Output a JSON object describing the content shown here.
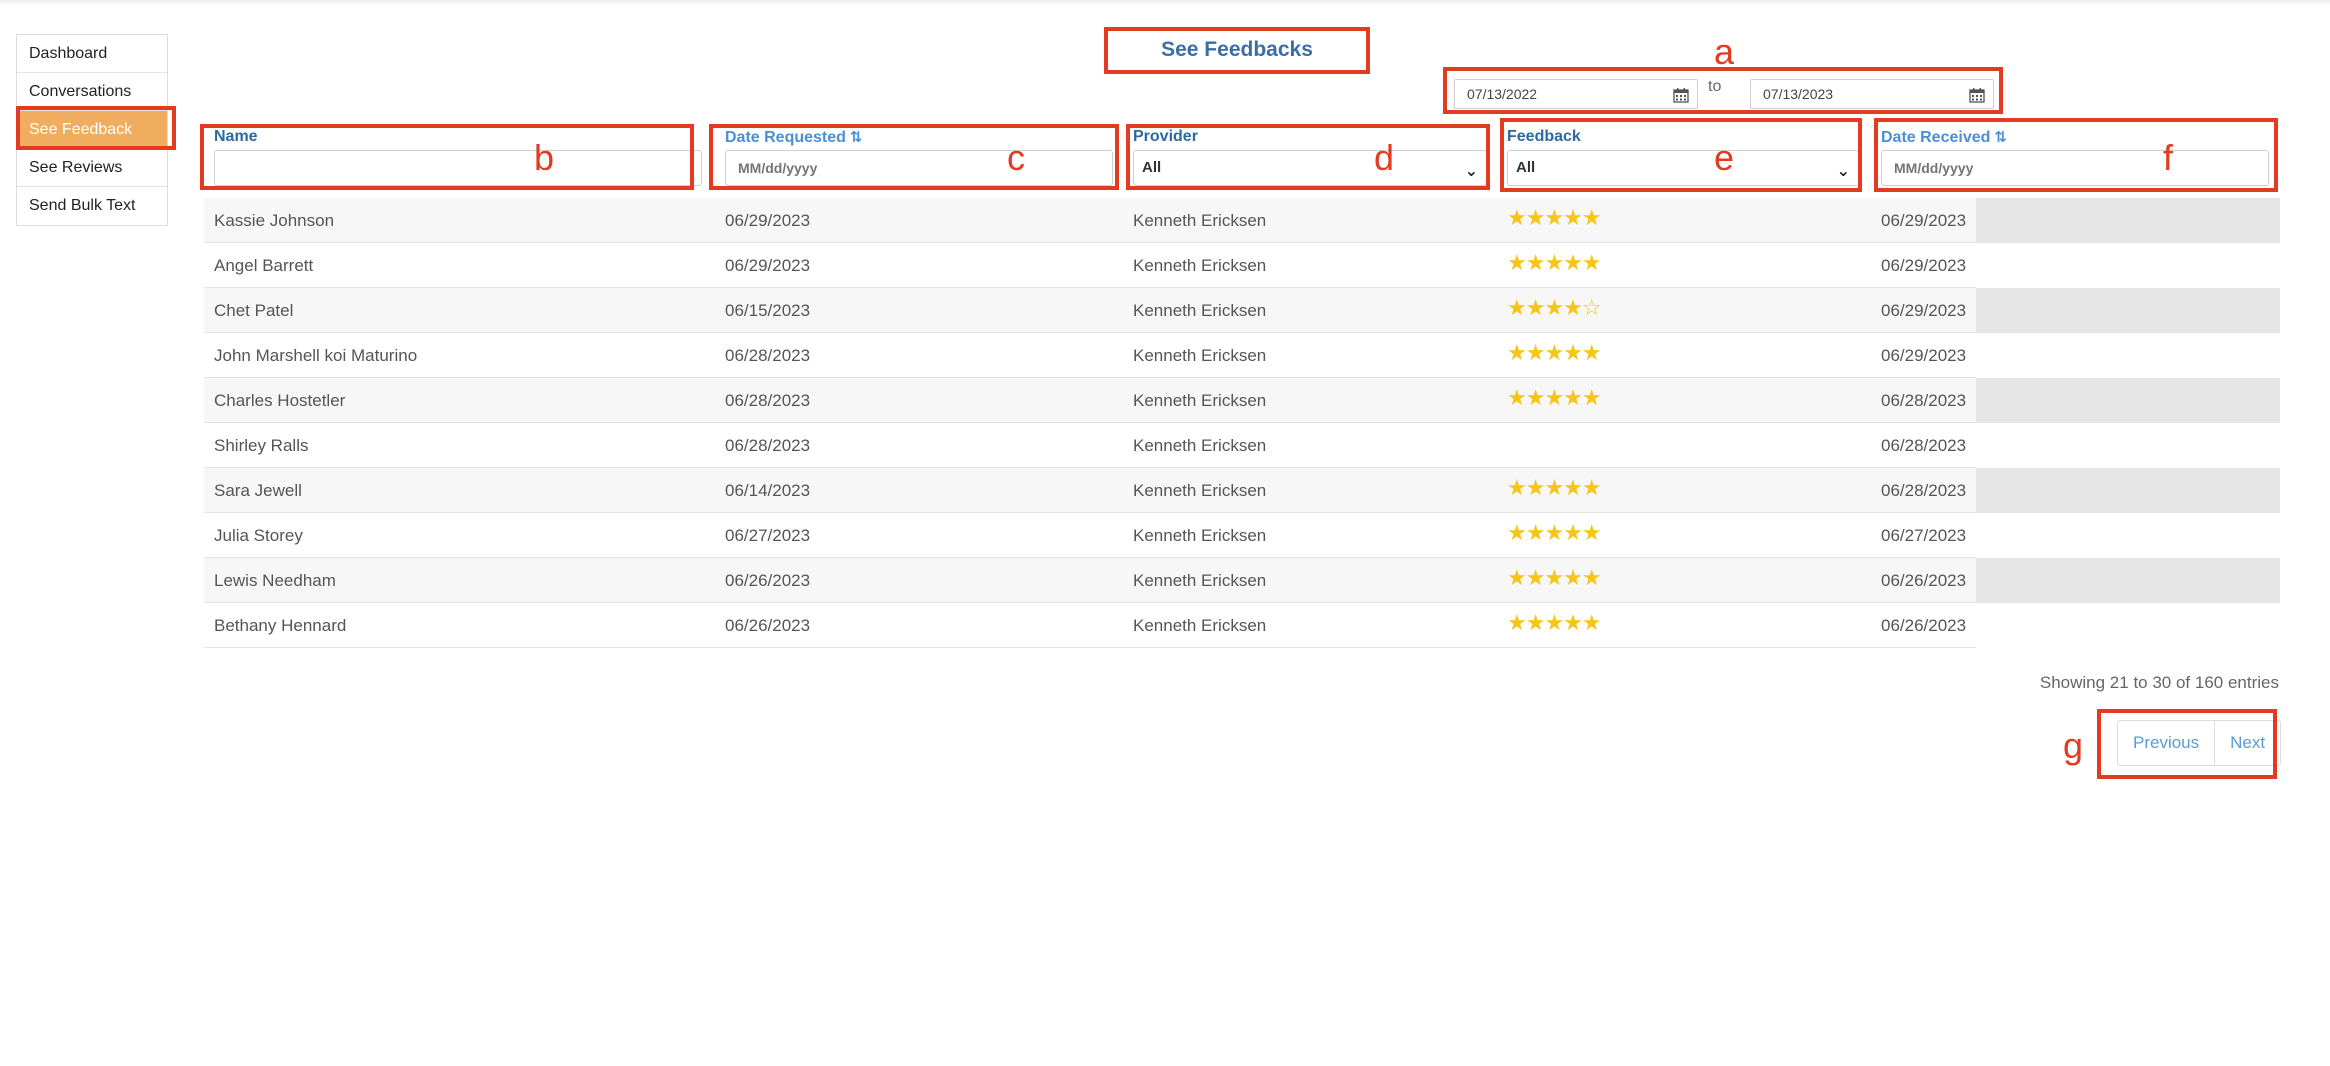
{
  "sidebar": {
    "items": [
      {
        "label": "Dashboard"
      },
      {
        "label": "Conversations"
      },
      {
        "label": "See Feedback"
      },
      {
        "label": "See Reviews"
      },
      {
        "label": "Send Bulk Text"
      }
    ],
    "active_index": 2
  },
  "page": {
    "title": "See Feedbacks"
  },
  "date_range": {
    "from": "07/13/2022",
    "to_label": "to",
    "to": "07/13/2023"
  },
  "columns": {
    "name": {
      "label": "Name",
      "placeholder": ""
    },
    "date_requested": {
      "label": "Date Requested",
      "placeholder": "MM/dd/yyyy",
      "sort_icon": "⇅"
    },
    "provider": {
      "label": "Provider",
      "selected": "All"
    },
    "feedback": {
      "label": "Feedback",
      "selected": "All"
    },
    "date_received": {
      "label": "Date Received",
      "placeholder": "MM/dd/yyyy",
      "sort_icon": "⇅"
    }
  },
  "rows": [
    {
      "name": "Kassie Johnson",
      "date_requested": "06/29/2023",
      "provider": "Kenneth Ericksen",
      "stars": "★★★★★",
      "date_received": "06/29/2023"
    },
    {
      "name": "Angel Barrett",
      "date_requested": "06/29/2023",
      "provider": "Kenneth Ericksen",
      "stars": "★★★★★",
      "date_received": "06/29/2023"
    },
    {
      "name": "Chet Patel",
      "date_requested": "06/15/2023",
      "provider": "Kenneth Ericksen",
      "stars": "★★★★☆",
      "date_received": "06/29/2023"
    },
    {
      "name": "John Marshell koi Maturino",
      "date_requested": "06/28/2023",
      "provider": "Kenneth Ericksen",
      "stars": "★★★★★",
      "date_received": "06/29/2023"
    },
    {
      "name": "Charles Hostetler",
      "date_requested": "06/28/2023",
      "provider": "Kenneth Ericksen",
      "stars": "★★★★★",
      "date_received": "06/28/2023"
    },
    {
      "name": "Shirley Ralls",
      "date_requested": "06/28/2023",
      "provider": "Kenneth Ericksen",
      "stars": "",
      "date_received": "06/28/2023"
    },
    {
      "name": "Sara Jewell",
      "date_requested": "06/14/2023",
      "provider": "Kenneth Ericksen",
      "stars": "★★★★★",
      "date_received": "06/28/2023"
    },
    {
      "name": "Julia Storey",
      "date_requested": "06/27/2023",
      "provider": "Kenneth Ericksen",
      "stars": "★★★★★",
      "date_received": "06/27/2023"
    },
    {
      "name": "Lewis Needham",
      "date_requested": "06/26/2023",
      "provider": "Kenneth Ericksen",
      "stars": "★★★★★",
      "date_received": "06/26/2023"
    },
    {
      "name": "Bethany Hennard",
      "date_requested": "06/26/2023",
      "provider": "Kenneth Ericksen",
      "stars": "★★★★★",
      "date_received": "06/26/2023"
    }
  ],
  "footer": {
    "entries_text": "Showing 21 to 30 of 160 entries",
    "previous_label": "Previous",
    "next_label": "Next"
  },
  "annotations": {
    "a": "a",
    "b": "b",
    "c": "c",
    "d": "d",
    "e": "e",
    "f": "f",
    "g": "g"
  },
  "colors": {
    "annotation": "#e23b22",
    "active_nav": "#f0ad60",
    "star": "#f5c518",
    "link": "#4a90d9"
  }
}
